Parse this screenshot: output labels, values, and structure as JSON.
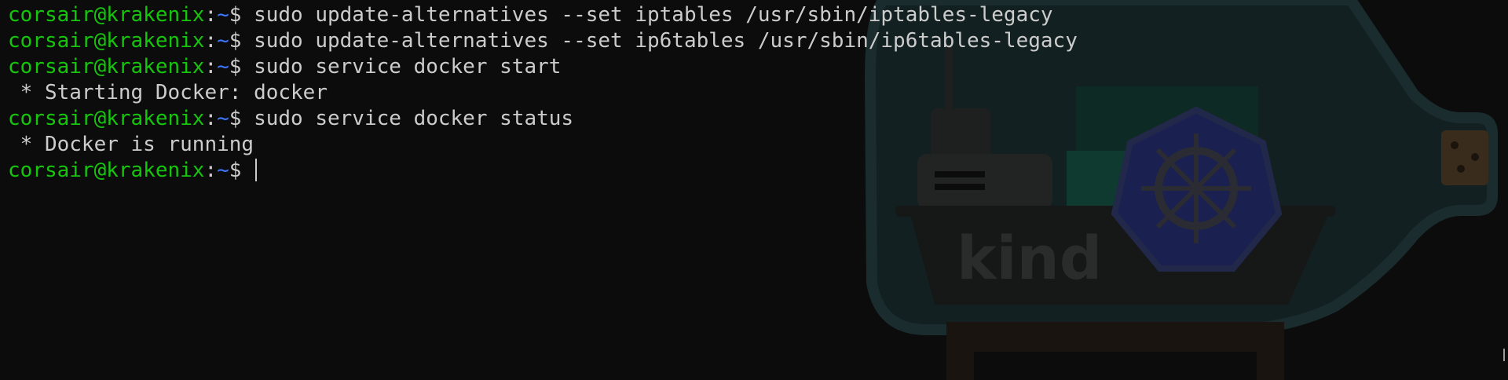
{
  "prompt": {
    "user": "corsair@krakenix",
    "separator": ":",
    "path": "~",
    "symbol": "$ "
  },
  "lines": [
    {
      "type": "prompt",
      "command": "sudo update-alternatives --set iptables /usr/sbin/iptables-legacy"
    },
    {
      "type": "prompt",
      "command": "sudo update-alternatives --set ip6tables /usr/sbin/ip6tables-legacy"
    },
    {
      "type": "prompt",
      "command": "sudo service docker start"
    },
    {
      "type": "output",
      "text": " * Starting Docker: docker"
    },
    {
      "type": "prompt",
      "command": "sudo service docker status"
    },
    {
      "type": "output",
      "text": " * Docker is running"
    },
    {
      "type": "prompt",
      "command": ""
    }
  ],
  "background": {
    "logo_text": "kind",
    "logo_icon": "kubernetes-helm-icon"
  },
  "colors": {
    "background": "#0c0c0c",
    "foreground": "#cccccc",
    "prompt_user": "#16c60c",
    "prompt_path": "#3b78ff"
  }
}
